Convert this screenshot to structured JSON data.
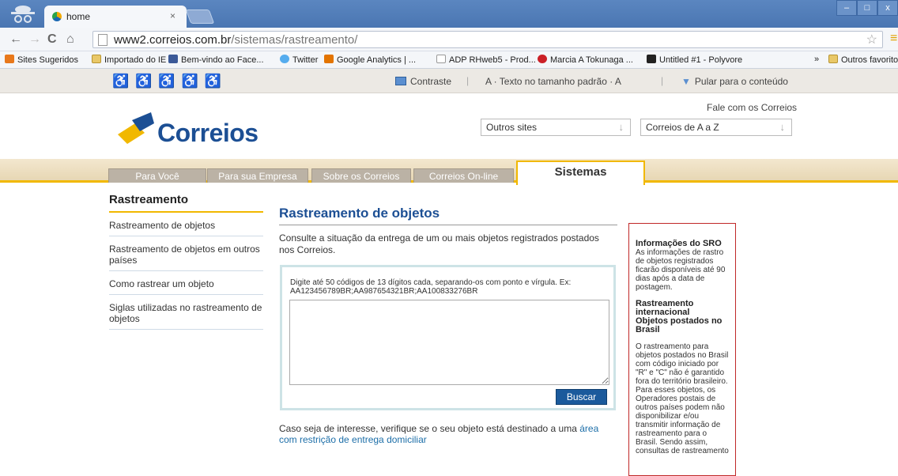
{
  "browser": {
    "tab_title": "home",
    "tab_close": "×",
    "url_host": "www2.correios.com.br",
    "url_path": "/sistemas/rastreamento/",
    "window_controls": [
      "–",
      "□",
      "x"
    ],
    "bookmarks": [
      {
        "label": "Sites Sugeridos",
        "icon": "orange-square-icon"
      },
      {
        "label": "Importado do IE",
        "icon": "folder-icon"
      },
      {
        "label": "Bem-vindo ao Face...",
        "icon": "facebook-icon"
      },
      {
        "label": "Twitter",
        "icon": "twitter-icon"
      },
      {
        "label": "Google Analytics | ...",
        "icon": "analytics-icon"
      },
      {
        "label": "ADP RHweb5 - Prod...",
        "icon": "page-icon"
      },
      {
        "label": "Marcia A Tokunaga ...",
        "icon": "pinterest-icon"
      },
      {
        "label": "Untitled #1 - Polyvore",
        "icon": "polyvore-icon"
      },
      {
        "label": "»",
        "icon": ""
      },
      {
        "label": "Outros favoritos",
        "icon": "folder-icon"
      }
    ]
  },
  "access_bar": {
    "contrast": "Contraste",
    "text_size": "A  ·  Texto no tamanho padrão  ·  A",
    "skip": "Pular para o conteúdo"
  },
  "header": {
    "fale": "Fale com os Correios",
    "logo_text": "Correios",
    "select_outros": "Outros sites",
    "select_az": "Correios de A a Z"
  },
  "nav": {
    "tabs": [
      "Para Você",
      "Para sua Empresa",
      "Sobre os Correios",
      "Correios On-line"
    ],
    "active": "Sistemas"
  },
  "sidebar": {
    "title": "Rastreamento",
    "items": [
      "Rastreamento de objetos",
      "Rastreamento de objetos em outros países",
      "Como rastrear um objeto",
      "Siglas utilizadas no rastreamento de objetos"
    ]
  },
  "main": {
    "title": "Rastreamento de objetos",
    "intro": "Consulte a situação da entrega de um ou mais objetos registrados postados nos Correios.",
    "hint": "Digite até 50 códigos de 13 dígitos cada, separando-os com ponto e vírgula. Ex: AA123456789BR;AA987654321BR;AA100833276BR",
    "button": "Buscar",
    "bottom_text": "Caso seja de interesse, verifique se o seu objeto está destinado a uma ",
    "bottom_link": "área com restrição de entrega domiciliar"
  },
  "sro": {
    "title1": "Informações do SRO",
    "text1": "As informações de rastro de objetos registrados ficarão disponíveis até 90 dias após a data de postagem.",
    "title2": "Rastreamento internacional",
    "title3": "Objetos postados no Brasil",
    "text2": "O rastreamento para objetos postados no Brasil com código iniciado por \"R\" e \"C\" não é garantido fora do território brasileiro. Para esses objetos, os Operadores postais de outros países podem não disponibilizar e/ou transmitir informação de rastreamento para o Brasil. Sendo assim, consultas de rastreamento"
  },
  "colors": {
    "brand_blue": "#1c4f94",
    "brand_yellow": "#f1b800",
    "sro_border": "#c02828"
  }
}
